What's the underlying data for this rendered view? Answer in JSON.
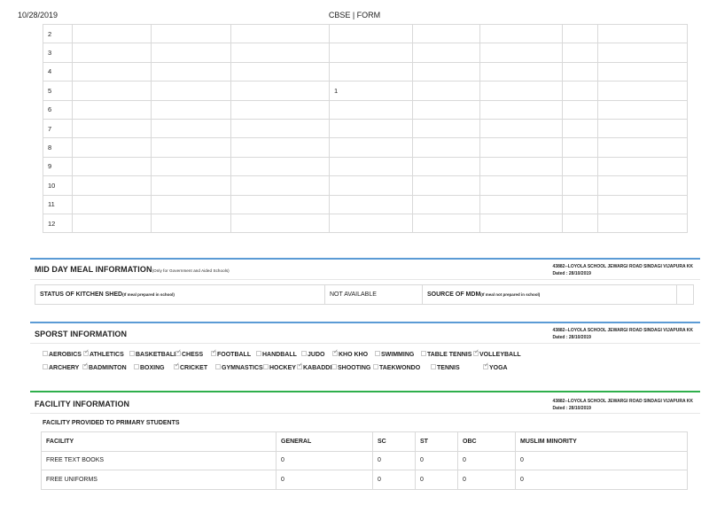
{
  "header": {
    "date": "10/28/2019",
    "title": "CBSE | FORM"
  },
  "grid": {
    "rows": [
      [
        "2",
        "",
        "",
        "",
        "",
        "",
        "",
        "",
        ""
      ],
      [
        "3",
        "",
        "",
        "",
        "",
        "",
        "",
        "",
        ""
      ],
      [
        "4",
        "",
        "",
        "",
        "",
        "",
        "",
        "",
        ""
      ],
      [
        "5",
        "",
        "",
        "",
        "1",
        "",
        "",
        "",
        ""
      ],
      [
        "6",
        "",
        "",
        "",
        "",
        "",
        "",
        "",
        ""
      ],
      [
        "7",
        "",
        "",
        "",
        "",
        "",
        "",
        "",
        ""
      ],
      [
        "8",
        "",
        "",
        "",
        "",
        "",
        "",
        "",
        ""
      ],
      [
        "9",
        "",
        "",
        "",
        "",
        "",
        "",
        "",
        ""
      ],
      [
        "10",
        "",
        "",
        "",
        "",
        "",
        "",
        "",
        ""
      ],
      [
        "11",
        "",
        "",
        "",
        "",
        "",
        "",
        "",
        ""
      ],
      [
        "12",
        "",
        "",
        "",
        "",
        "",
        "",
        "",
        ""
      ]
    ]
  },
  "mdm": {
    "title": "MID DAY MEAL INFORMATION",
    "title_note": "(Only for Government and Aided Schools)",
    "school": "43882--LOYOLA SCHOOL JEWARGI ROAD SINDAGI VIJAPURA KK",
    "dated": "Dated : 28/10/2019",
    "kitchen_label": "STATUS OF KITCHEN SHED",
    "kitchen_note": "(If meal prepared in school)",
    "kitchen_value": "NOT AVAILABLE",
    "source_label": "SOURCE OF MDM",
    "source_note": "(If meal not prepared in school)",
    "source_value": ""
  },
  "sports": {
    "title": "SPORST INFORMATION",
    "school": "43882--LOYOLA SCHOOL JEWARGI ROAD SINDAGI VIJAPURA KK",
    "dated": "Dated : 28/10/2019",
    "row1": [
      {
        "label": "AEROBICS",
        "checked": false
      },
      {
        "label": "ATHLETICS",
        "checked": true
      },
      {
        "label": "BASKETBALL",
        "checked": false
      },
      {
        "label": "CHESS",
        "checked": true
      },
      {
        "label": "FOOTBALL",
        "checked": true
      },
      {
        "label": "HANDBALL",
        "checked": false
      },
      {
        "label": "JUDO",
        "checked": false
      },
      {
        "label": "KHO KHO",
        "checked": true
      },
      {
        "label": "SWIMMING",
        "checked": false
      },
      {
        "label": "TABLE TENNIS",
        "checked": false
      },
      {
        "label": "VOLLEYBALL",
        "checked": true
      }
    ],
    "row2": [
      {
        "label": "ARCHERY",
        "checked": false
      },
      {
        "label": "BADMINTON",
        "checked": true
      },
      {
        "label": "BOXING",
        "checked": false
      },
      {
        "label": "CRICKET",
        "checked": true
      },
      {
        "label": "GYMNASTICS",
        "checked": false
      },
      {
        "label": "HOCKEY",
        "checked": false
      },
      {
        "label": "KABADDI",
        "checked": true
      },
      {
        "label": "SHOOTING",
        "checked": false
      },
      {
        "label": "TAEKWONDO",
        "checked": false
      },
      {
        "label": "TENNIS",
        "checked": false
      },
      {
        "label": "YOGA",
        "checked": true
      }
    ]
  },
  "facility": {
    "title": "FACILITY INFORMATION",
    "school": "43882--LOYOLA SCHOOL JEWARGI ROAD SINDAGI VIJAPURA KK",
    "dated": "Dated : 28/10/2019",
    "subtitle": "FACILITY PROVIDED TO PRIMARY STUDENTS",
    "headers": [
      "FACILITY",
      "GENERAL",
      "SC",
      "ST",
      "OBC",
      "MUSLIM MINORITY"
    ],
    "rows": [
      [
        "FREE TEXT BOOKS",
        "0",
        "0",
        "0",
        "0",
        "0"
      ],
      [
        "FREE UNIFORMS",
        "0",
        "0",
        "0",
        "0",
        "0"
      ]
    ]
  },
  "colors": {
    "blue_bar": "#5b9bd5",
    "green_bar": "#2eaf4b",
    "border": "#d9d9d9"
  }
}
